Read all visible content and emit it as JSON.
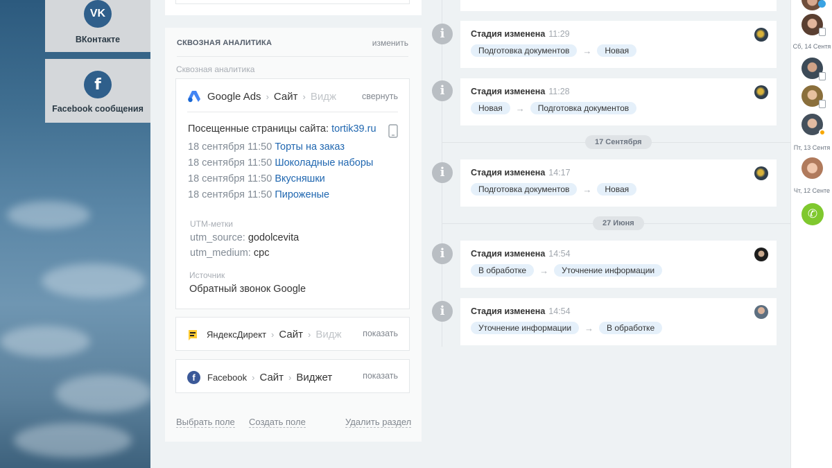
{
  "apps": [
    {
      "label": "ВКонтакте",
      "icon": "vk-icon",
      "glyph": "VK"
    },
    {
      "label": "Facebook сообщения",
      "icon": "facebook-icon",
      "glyph": "f"
    }
  ],
  "analytics": {
    "title": "СКВОЗНАЯ АНАЛИТИКА",
    "edit": "изменить",
    "sublabel": "Сквозная аналитика",
    "google": {
      "source": "Google Ads",
      "crumb1": "Сайт",
      "crumb2": "Видж",
      "toggle": "свернуть",
      "visited_label": "Посещенные страницы сайта:",
      "site": "tortik39.ru",
      "visits": [
        {
          "date": "18 сентября 11:50",
          "page": "Торты на заказ"
        },
        {
          "date": "18 сентября 11:50",
          "page": "Шоколадные наборы"
        },
        {
          "date": "18 сентября 11:50",
          "page": "Вкусняшки"
        },
        {
          "date": "18 сентября 11:50",
          "page": "Пироженые"
        }
      ],
      "utm_label": "UTM-метки",
      "utm": [
        {
          "key": "utm_source:",
          "value": "godolcevita"
        },
        {
          "key": "utm_medium:",
          "value": "cpc"
        }
      ],
      "source_label": "Источник",
      "source_value": "Обратный звонок Google"
    },
    "yandex": {
      "source": "ЯндексДирект",
      "crumb1": "Сайт",
      "crumb2": "Видж",
      "toggle": "показать"
    },
    "facebook": {
      "source": "Facebook",
      "crumb1": "Сайт",
      "crumb2": "Виджет",
      "toggle": "показать"
    },
    "footer": {
      "select": "Выбрать поле",
      "create": "Создать поле",
      "delete": "Удалить раздел"
    }
  },
  "timeline": {
    "dates": [
      "17 Сентября",
      "27 Июня"
    ],
    "events": [
      {
        "title": "Стадия изменена",
        "time": "11:29",
        "from": "Подготовка документов",
        "to": "Новая"
      },
      {
        "title": "Стадия изменена",
        "time": "11:28",
        "from": "Новая",
        "to": "Подготовка документов"
      },
      {
        "title": "Стадия изменена",
        "time": "14:17",
        "from": "Подготовка документов",
        "to": "Новая"
      },
      {
        "title": "Стадия изменена",
        "time": "14:54",
        "from": "В обработке",
        "to": "Уточнение информации"
      },
      {
        "title": "Стадия изменена",
        "time": "14:54",
        "from": "Уточнение информации",
        "to": "В обработке"
      }
    ],
    "arrow": "→"
  },
  "rightbar": {
    "dates": [
      "Сб, 14 Сентя",
      "Пт, 13 Сентя",
      "Чт, 12 Сенте"
    ]
  },
  "colors": {
    "accent": "#2067b0",
    "stage_bg": "#e5f0fa",
    "call": "#7fc82e",
    "google_blue": "#4285f4",
    "yandex_yellow": "#fc3"
  }
}
